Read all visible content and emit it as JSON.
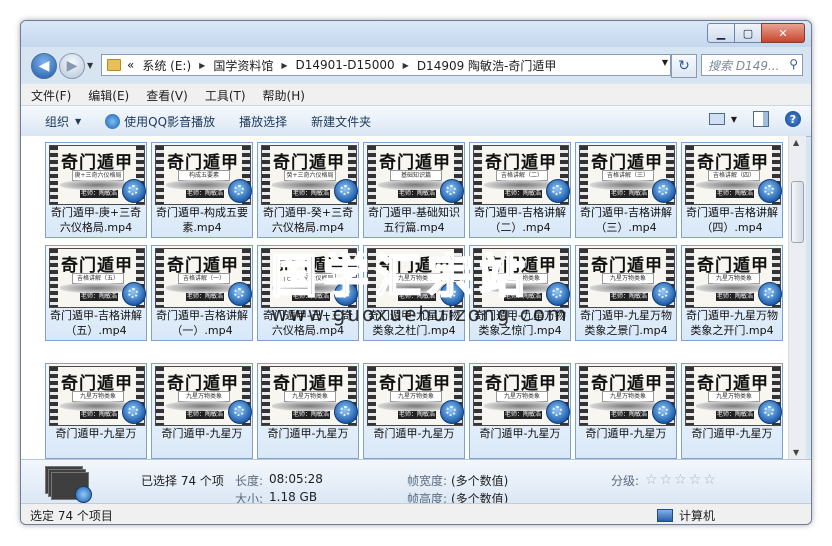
{
  "address": {
    "crumbs": [
      "系统 (E:)",
      "国学资料馆",
      "D14901-D15000",
      "D14909 陶敏浩-奇门遁甲"
    ],
    "overflow_marker": "«"
  },
  "search": {
    "placeholder": "搜索 D149..."
  },
  "menu": [
    "文件(F)",
    "编辑(E)",
    "查看(V)",
    "工具(T)",
    "帮助(H)"
  ],
  "toolbar": {
    "organize": "组织",
    "play_qq": "使用QQ影音播放",
    "play_selection": "播放选择",
    "new_folder": "新建文件夹"
  },
  "thumb_art": {
    "title": "奇门遁甲",
    "tag": "老师：陶敏浩"
  },
  "files": [
    {
      "caption": "奇门遁甲-庚+三奇六仪格局.mp4",
      "sub": "庚+三奇六仪格局"
    },
    {
      "caption": "奇门遁甲-构成五要素.mp4",
      "sub": "构成五要素"
    },
    {
      "caption": "奇门遁甲-癸+三奇六仪格局.mp4",
      "sub": "癸+三奇六仪格局"
    },
    {
      "caption": "奇门遁甲-基础知识五行篇.mp4",
      "sub": "基础知识篇"
    },
    {
      "caption": "奇门遁甲-吉格讲解（二）.mp4",
      "sub": "吉格讲解（二）"
    },
    {
      "caption": "奇门遁甲-吉格讲解（三）.mp4",
      "sub": "吉格讲解（三）"
    },
    {
      "caption": "奇门遁甲-吉格讲解（四）.mp4",
      "sub": "吉格讲解（四）"
    },
    {
      "caption": "奇门遁甲-吉格讲解（五）.mp4",
      "sub": "吉格讲解（五）"
    },
    {
      "caption": "奇门遁甲-吉格讲解（一）.mp4",
      "sub": "吉格讲解（一）"
    },
    {
      "caption": "奇门遁甲-己+三奇六仪格局.mp4",
      "sub": "己+三奇六仪格局"
    },
    {
      "caption": "奇门遁甲-九星万物类象之杜门.mp4",
      "sub": "九星万物类象"
    },
    {
      "caption": "奇门遁甲-九星万物类象之惊门.mp4",
      "sub": "九星万物类象"
    },
    {
      "caption": "奇门遁甲-九星万物类象之景门.mp4",
      "sub": "九星万物类象"
    },
    {
      "caption": "奇门遁甲-九星万物类象之开门.mp4",
      "sub": "九星万物类象"
    },
    {
      "caption": "奇门遁甲-九星万",
      "sub": "九星万物类象"
    },
    {
      "caption": "奇门遁甲-九星万",
      "sub": "九星万物类象"
    },
    {
      "caption": "奇门遁甲-九星万",
      "sub": "九星万物类象"
    },
    {
      "caption": "奇门遁甲-九星万",
      "sub": "九星万物类象"
    },
    {
      "caption": "奇门遁甲-九星万",
      "sub": "九星万物类象"
    },
    {
      "caption": "奇门遁甲-九星万",
      "sub": "九星万物类象"
    },
    {
      "caption": "奇门遁甲-九星万",
      "sub": "九星万物类象"
    }
  ],
  "watermark": {
    "big": "国学汇宗站",
    "url": "www.guoxuehuizong.com"
  },
  "details": {
    "selected": "已选择 74 个项",
    "duration_label": "长度:",
    "duration_value": "08:05:28",
    "size_label": "大小:",
    "size_value": "1.18 GB",
    "frame_width_label": "帧宽度:",
    "frame_width_value": "(多个数值)",
    "frame_height_label": "帧高度:",
    "frame_height_value": "(多个数值)",
    "rating_label": "分级:",
    "rating": 0
  },
  "status": {
    "left": "选定 74 个项目",
    "right": "计算机"
  },
  "colors": {
    "accent": "#1f5ead",
    "selection": "#d9e8f8",
    "selection_border": "#7da2ce"
  }
}
